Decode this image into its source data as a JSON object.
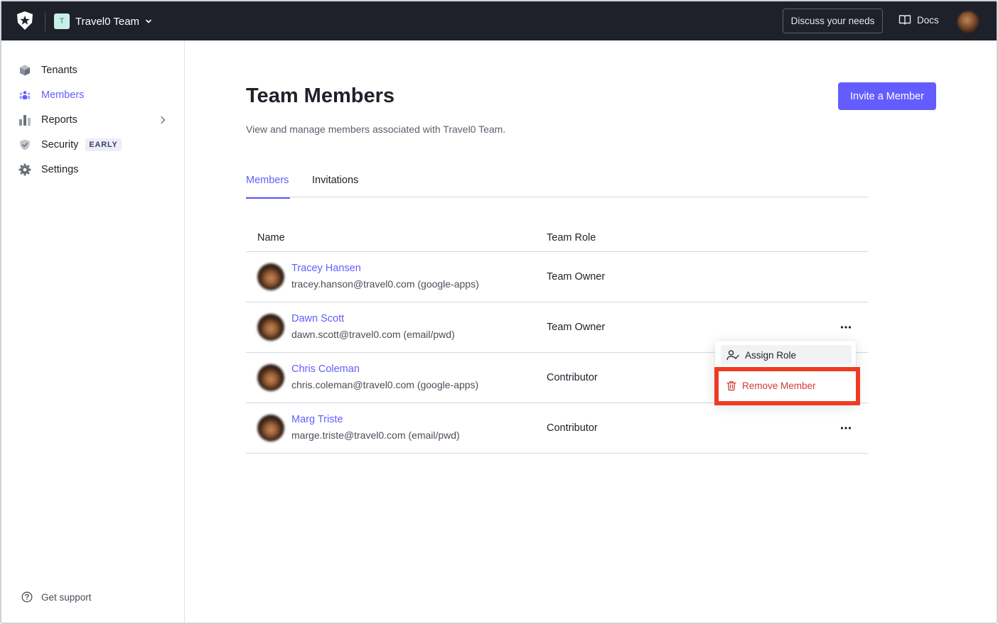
{
  "topbar": {
    "team_initial": "T",
    "team_name": "Travel0 Team",
    "discuss_label": "Discuss your needs",
    "docs_label": "Docs"
  },
  "sidebar": {
    "items": [
      {
        "label": "Tenants",
        "icon": "cube-icon"
      },
      {
        "label": "Members",
        "icon": "members-icon",
        "active": true
      },
      {
        "label": "Reports",
        "icon": "bar-chart-icon",
        "has_chevron": true
      },
      {
        "label": "Security",
        "icon": "shield-check-icon",
        "badge": "EARLY"
      },
      {
        "label": "Settings",
        "icon": "gear-icon"
      }
    ],
    "support_label": "Get support"
  },
  "main": {
    "title": "Team Members",
    "description": "View and manage members associated with Travel0 Team.",
    "invite_label": "Invite a Member",
    "tabs": [
      {
        "label": "Members",
        "active": true
      },
      {
        "label": "Invitations",
        "active": false
      }
    ],
    "table": {
      "columns": [
        "Name",
        "Team Role"
      ],
      "rows": [
        {
          "name": "Tracey Hansen",
          "email": "tracey.hanson@travel0.com (google-apps)",
          "role": "Team Owner"
        },
        {
          "name": "Dawn Scott",
          "email": "dawn.scott@travel0.com (email/pwd)",
          "role": "Team Owner"
        },
        {
          "name": "Chris Coleman",
          "email": "chris.coleman@travel0.com (google-apps)",
          "role": "Contributor"
        },
        {
          "name": "Marg Triste",
          "email": "marge.triste@travel0.com (email/pwd)",
          "role": "Contributor"
        }
      ]
    },
    "row_menu": {
      "assign_label": "Assign Role",
      "remove_label": "Remove Member"
    }
  },
  "colors": {
    "accent": "#635dff",
    "topbar": "#1e212a",
    "danger": "#d03c38",
    "highlight": "#ef3b24"
  }
}
